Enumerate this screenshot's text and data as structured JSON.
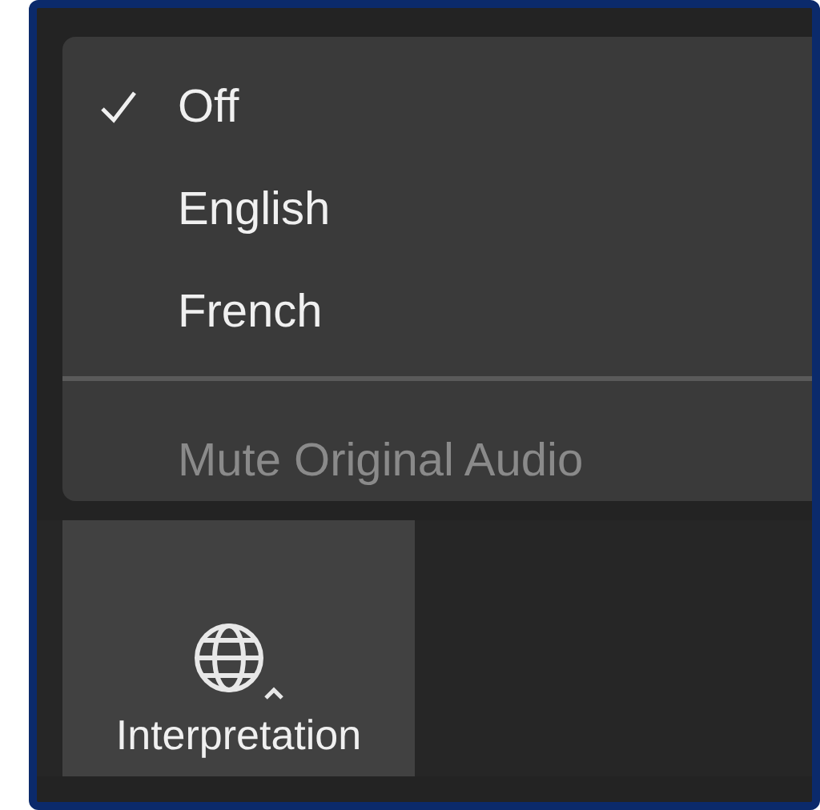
{
  "menu": {
    "items": [
      {
        "label": "Off",
        "selected": true
      },
      {
        "label": "English",
        "selected": false
      },
      {
        "label": "French",
        "selected": false
      }
    ],
    "mute_option": {
      "label": "Mute Original Audio",
      "disabled": true
    }
  },
  "toolbar": {
    "button": {
      "label": "Interpretation"
    }
  }
}
